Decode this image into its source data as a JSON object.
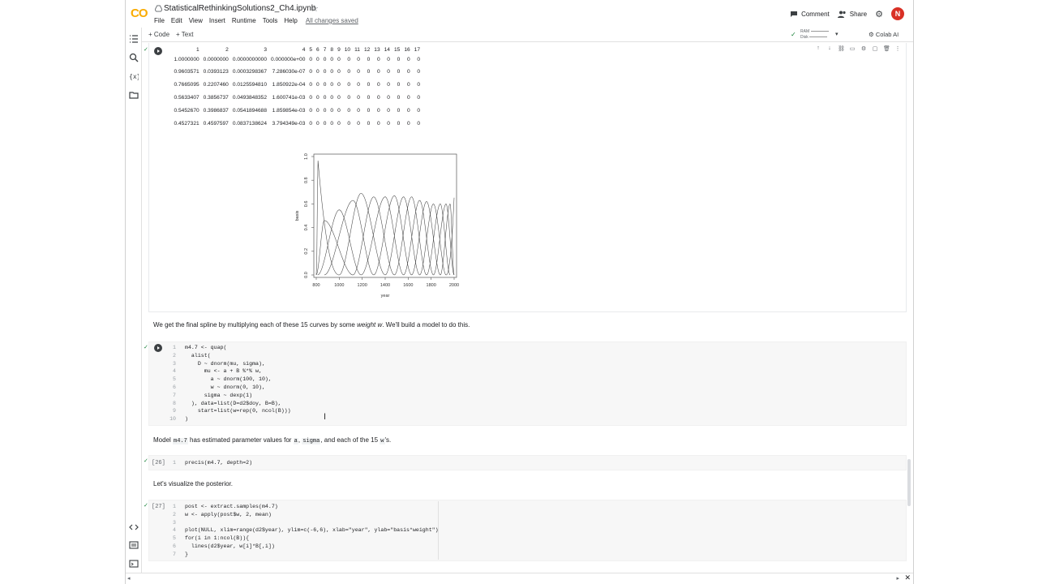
{
  "app": {
    "logo": "CO",
    "title": "StatisticalRethinkingSolutions2_Ch4.ipynb",
    "menu": [
      "File",
      "Edit",
      "View",
      "Insert",
      "Runtime",
      "Tools",
      "Help"
    ],
    "save_status": "All changes saved",
    "comment_label": "Comment",
    "share_label": "Share",
    "avatar_letter": "N"
  },
  "toolbar": {
    "add_code": "+ Code",
    "add_text": "+ Text",
    "ram_label": "RAM",
    "disk_label": "Disk",
    "colab_ai": "Colab AI"
  },
  "output_table": {
    "headers": [
      "1",
      "2",
      "3",
      "4",
      "5",
      "6",
      "7",
      "8",
      "9",
      "10",
      "11",
      "12",
      "13",
      "14",
      "15",
      "16",
      "17"
    ],
    "rows": [
      [
        "1.0000000",
        "0.0000000",
        "0.0000000000",
        "0.000000e+00",
        "0",
        "0",
        "0",
        "0",
        "0",
        "0",
        "0",
        "0",
        "0",
        "0",
        "0",
        "0",
        "0"
      ],
      [
        "0.9603571",
        "0.0393123",
        "0.0003298367",
        "7.286030e-07",
        "0",
        "0",
        "0",
        "0",
        "0",
        "0",
        "0",
        "0",
        "0",
        "0",
        "0",
        "0",
        "0"
      ],
      [
        "0.7665095",
        "0.2207460",
        "0.0125594810",
        "1.850922e-04",
        "0",
        "0",
        "0",
        "0",
        "0",
        "0",
        "0",
        "0",
        "0",
        "0",
        "0",
        "0",
        "0"
      ],
      [
        "0.5633407",
        "0.3856737",
        "0.0493848352",
        "1.600741e-03",
        "0",
        "0",
        "0",
        "0",
        "0",
        "0",
        "0",
        "0",
        "0",
        "0",
        "0",
        "0",
        "0"
      ],
      [
        "0.5452670",
        "0.3986837",
        "0.0541894688",
        "1.859854e-03",
        "0",
        "0",
        "0",
        "0",
        "0",
        "0",
        "0",
        "0",
        "0",
        "0",
        "0",
        "0",
        "0"
      ],
      [
        "0.4527321",
        "0.4597597",
        "0.0837138624",
        "3.794349e-03",
        "0",
        "0",
        "0",
        "0",
        "0",
        "0",
        "0",
        "0",
        "0",
        "0",
        "0",
        "0",
        "0"
      ]
    ]
  },
  "chart_data": {
    "type": "line",
    "title": "",
    "xlabel": "year",
    "ylabel": "basis",
    "xlim": [
      800,
      2000
    ],
    "ylim": [
      0,
      1
    ],
    "x_ticks": [
      "800",
      "1000",
      "1200",
      "1400",
      "1600",
      "1800",
      "2000"
    ],
    "y_ticks": [
      "0.0",
      "0.2",
      "0.4",
      "0.6",
      "0.8",
      "1.0"
    ],
    "series_count": 17,
    "basis_peaks": [
      {
        "center": 812,
        "height": 1.0
      },
      {
        "center": 870,
        "height": 0.46
      },
      {
        "center": 1000,
        "height": 0.55
      },
      {
        "center": 1120,
        "height": 0.63
      },
      {
        "center": 1190,
        "height": 0.69
      },
      {
        "center": 1300,
        "height": 0.66
      },
      {
        "center": 1400,
        "height": 0.66
      },
      {
        "center": 1480,
        "height": 0.67
      },
      {
        "center": 1560,
        "height": 0.66
      },
      {
        "center": 1630,
        "height": 0.66
      },
      {
        "center": 1700,
        "height": 0.63
      },
      {
        "center": 1760,
        "height": 0.62
      },
      {
        "center": 1820,
        "height": 0.6
      },
      {
        "center": 1880,
        "height": 0.6
      },
      {
        "center": 1930,
        "height": 0.6
      },
      {
        "center": 1965,
        "height": 0.6
      },
      {
        "center": 2015,
        "height": 1.0
      }
    ]
  },
  "md1": {
    "text_a": "We get the final spline by multiplying each of these 15 curves by some ",
    "text_em": "weight w",
    "text_b": ". We'll build a model to do this."
  },
  "code1": {
    "line_numbers": [
      "1",
      "2",
      "3",
      "4",
      "5",
      "6",
      "7",
      "8",
      "9",
      "10"
    ],
    "lines": [
      "m4.7 <- quap(",
      "  alist(",
      "    D ~ dnorm(mu, sigma),",
      "      mu <- a + B %*% w,",
      "        a ~ dnorm(100, 10),",
      "        w ~ dnorm(0, 10),",
      "      sigma ~ dexp(1)",
      "  ), data=list(D=d2$doy, B=B),",
      "    start=list(w=rep(0, ncol(B)))",
      ")"
    ]
  },
  "md2": {
    "a": "Model ",
    "c1": "m4.7",
    "b": " has estimated parameter values for ",
    "c2": "a",
    "c": ", ",
    "c3": "sigma",
    "d": ", and each of the 15 ",
    "c4": "w",
    "e": "'s."
  },
  "code2": {
    "exec": "[26]",
    "line_number": "1",
    "line": "precis(m4.7, depth=2)"
  },
  "md3": {
    "text": "Let's visualize the posterior."
  },
  "code3": {
    "exec": "[27]",
    "line_numbers": [
      "1",
      "2",
      "3",
      "4",
      "5",
      "6",
      "7"
    ],
    "lines": [
      "post <- extract.samples(m4.7)",
      "w <- apply(post$w, 2, mean)",
      "",
      "plot(NULL, xlim=range(d2$year), ylim=c(-6,6), xlab=\"year\", ylab=\"basis*weight\")",
      "for(i in 1:ncol(B)){",
      "  lines(d2$year, w[i]*B[,i])",
      "}"
    ]
  }
}
